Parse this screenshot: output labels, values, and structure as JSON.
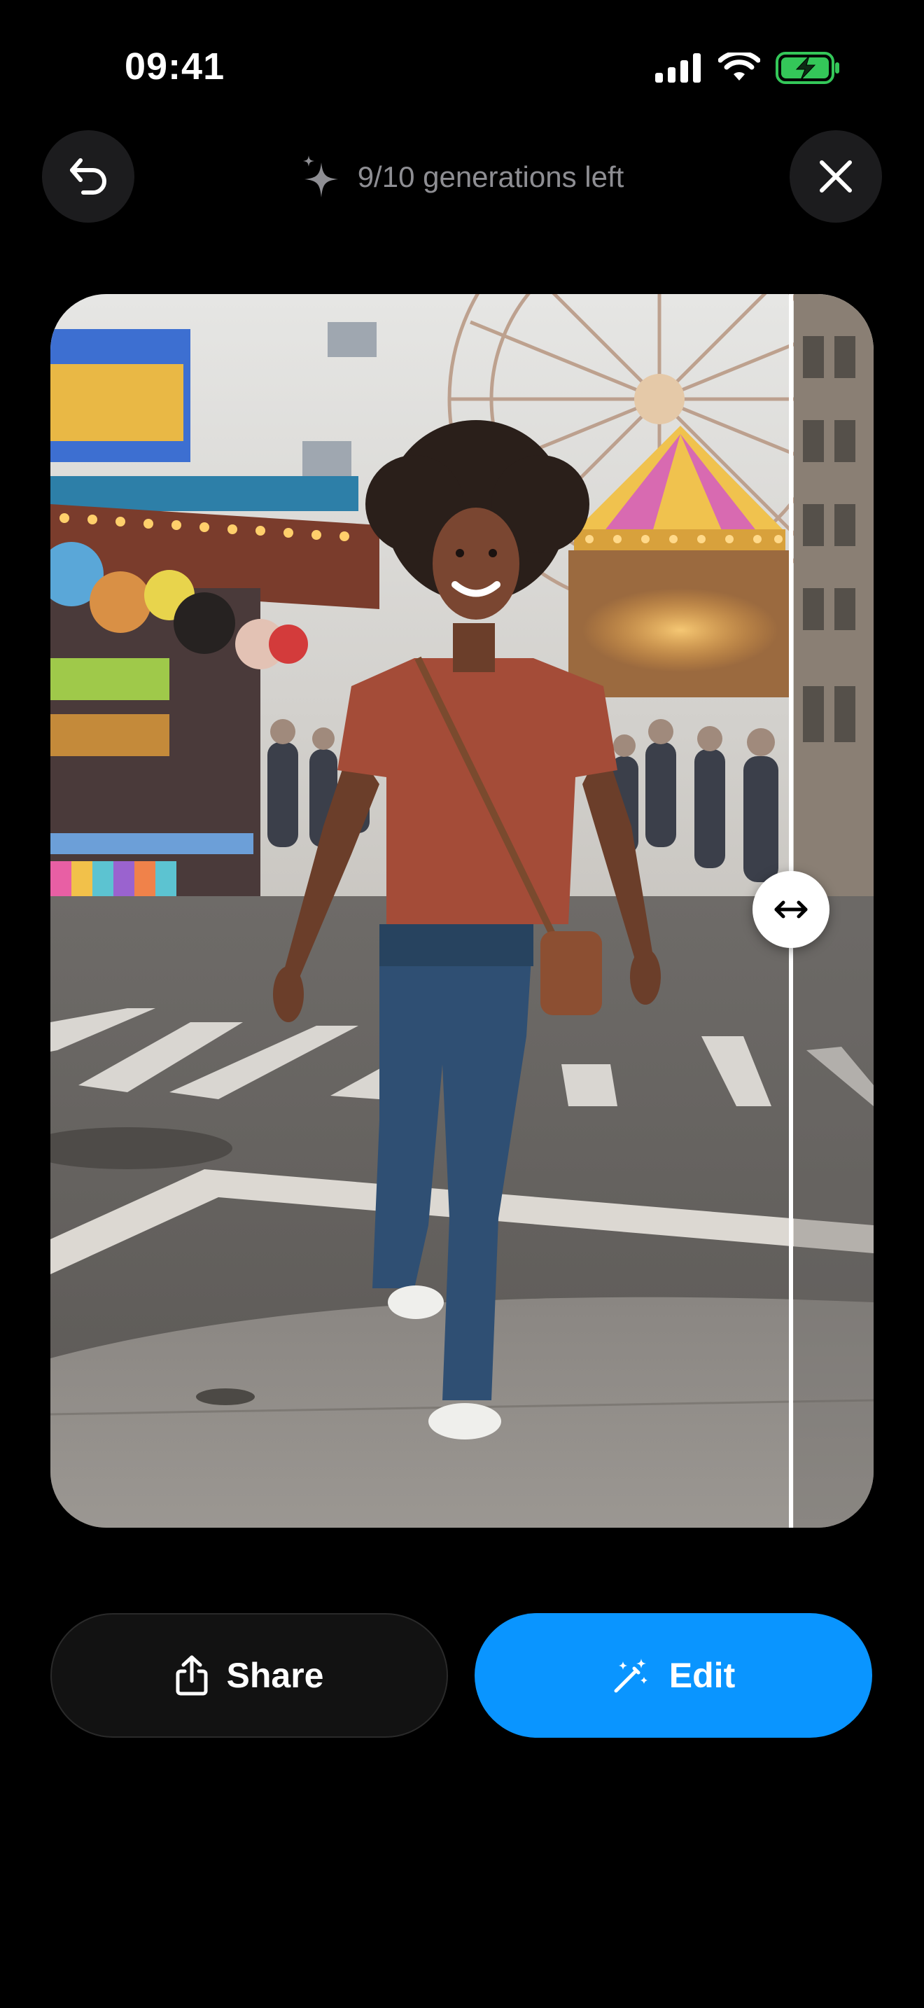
{
  "status_bar": {
    "time": "09:41",
    "icons": [
      "cellular-signal-icon",
      "wifi-icon",
      "battery-charging-icon"
    ],
    "battery_color": "#34c759"
  },
  "top_bar": {
    "back_icon": "undo-arrow-icon",
    "credits_icon": "sparkle-icon",
    "credits_text": "9/10 generations left",
    "close_icon": "close-icon"
  },
  "comparison": {
    "divider_handle_icon": "horizontal-arrows-icon",
    "divider_position": 0.9
  },
  "actions": {
    "share_label": "Share",
    "share_icon": "share-icon",
    "edit_label": "Edit",
    "edit_icon": "magic-wand-icon"
  },
  "colors": {
    "background": "#000000",
    "accent": "#0a95ff",
    "secondary_button": "#121212",
    "muted_text": "#8e8e93"
  }
}
